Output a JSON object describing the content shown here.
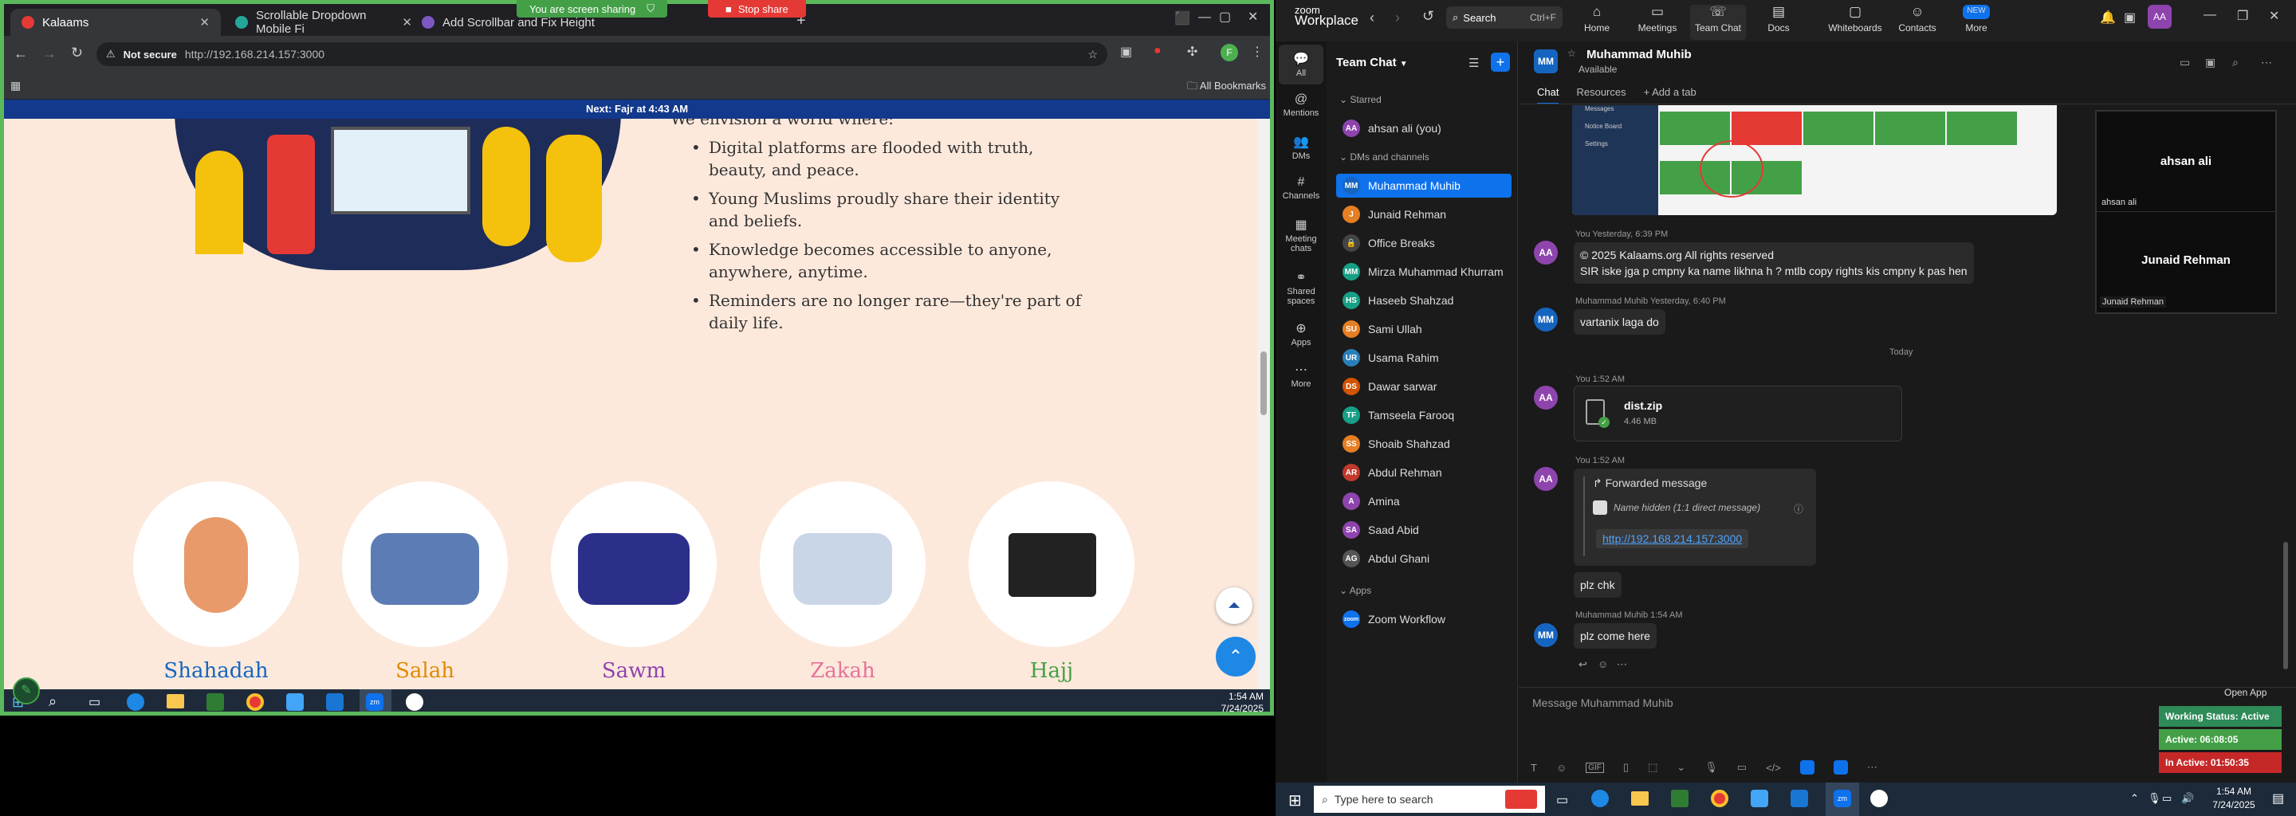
{
  "browser": {
    "tabs": [
      {
        "label": "Kalaams",
        "color": "#e53935"
      },
      {
        "label": "Scrollable Dropdown Mobile Fi",
        "color": "#26a69a"
      },
      {
        "label": "Add Scrollbar and Fix Height",
        "color": "#7e57c2"
      }
    ],
    "sharing_banner": "You are screen sharing",
    "stop_share": "Stop share",
    "not_secure": "Not secure",
    "url": "http://192.168.214.157:3000",
    "all_bookmarks": "All Bookmarks",
    "profile_initial": "F"
  },
  "page": {
    "banner": "Next: Fajr at 4:43 AM",
    "intro": "We envision a world where:",
    "bullets": [
      "Digital platforms are flooded with truth, beauty, and peace.",
      "Young Muslims proudly share their identity and beliefs.",
      "Knowledge becomes accessible to anyone, anywhere, anytime.",
      "Reminders are no longer rare—they're part of daily life."
    ],
    "pillars": [
      {
        "label": "Shahadah",
        "color": "#1565c0"
      },
      {
        "label": "Salah",
        "color": "#e08a00"
      },
      {
        "label": "Sawm",
        "color": "#8e44ad"
      },
      {
        "label": "Zakah",
        "color": "#e57399"
      },
      {
        "label": "Hajj",
        "color": "#43a047"
      }
    ]
  },
  "left_taskbar": {
    "time": "1:54 AM",
    "date": "7/24/2025"
  },
  "zoom": {
    "brand_top": "zoom",
    "brand_bottom": "Workplace",
    "search": "Search",
    "search_shortcut": "Ctrl+F",
    "nav": [
      "Home",
      "Meetings",
      "Team Chat",
      "Docs",
      "Whiteboards",
      "Contacts",
      "More"
    ],
    "nav_new_badge": "NEW",
    "avatar_initials": "AA",
    "rail": [
      "All",
      "Mentions",
      "DMs",
      "Channels",
      "Meeting chats",
      "Shared spaces",
      "Apps",
      "More"
    ],
    "list_title": "Team Chat",
    "starred_header": "Starred",
    "starred": [
      {
        "name": "ahsan ali (you)",
        "init": "AA",
        "color": "#8e44ad"
      }
    ],
    "dms_header": "DMs and channels",
    "dms": [
      {
        "name": "Muhammad Muhib",
        "init": "MM",
        "color": "#1565c0"
      },
      {
        "name": "Junaid Rehman",
        "init": "J",
        "color": "#e67e22"
      },
      {
        "name": "Office Breaks",
        "init": "🔒",
        "color": "#444"
      },
      {
        "name": "Mirza Muhammad Khurram",
        "init": "MM",
        "color": "#16a085"
      },
      {
        "name": "Haseeb Shahzad",
        "init": "HS",
        "color": "#16a085"
      },
      {
        "name": "Sami Ullah",
        "init": "SU",
        "color": "#e67e22"
      },
      {
        "name": "Usama Rahim",
        "init": "UR",
        "color": "#2980b9"
      },
      {
        "name": "Dawar sarwar",
        "init": "DS",
        "color": "#d35400"
      },
      {
        "name": "Tamseela Farooq",
        "init": "TF",
        "color": "#16a085"
      },
      {
        "name": "Shoaib Shahzad",
        "init": "SS",
        "color": "#e67e22"
      },
      {
        "name": "Abdul Rehman",
        "init": "AR",
        "color": "#c0392b"
      },
      {
        "name": "Amina",
        "init": "A",
        "color": "#8e44ad"
      },
      {
        "name": "Saad Abid",
        "init": "SA",
        "color": "#8e44ad"
      },
      {
        "name": "Abdul Ghani",
        "init": "AG",
        "color": "#555"
      }
    ],
    "apps_header": "Apps",
    "apps": [
      {
        "name": "Zoom Workflow",
        "init": "zoom",
        "color": "#0e72ed"
      }
    ],
    "chat_title": "Muhammad Muhib",
    "chat_initials": "MM",
    "chat_status": "Available",
    "chat_tabs": [
      "Chat",
      "Resources",
      "+ Add a tab"
    ],
    "messages": {
      "m1_meta": "You Yesterday, 6:39 PM",
      "m1_line1": "© 2025 Kalaams.org All rights reserved",
      "m1_line2": "SIR iske jga p cmpny ka name likhna h ?  mtlb copy rights kis cmpny k pas hen",
      "m2_meta": "Muhammad Muhib Yesterday, 6:40 PM",
      "m2_text": "vartanix laga do",
      "today": "Today",
      "m3_meta": "You 1:52 AM",
      "m3_file": "dist.zip",
      "m3_size": "4.46 MB",
      "m4_meta": "You 1:52 AM",
      "m4_fwd": "Forwarded message",
      "m4_hidden": "Name hidden (1:1 direct message)",
      "m4_link": "http://192.168.214.157:3000",
      "m4_text": "plz chk",
      "m5_meta": "Muhammad Muhib 1:54 AM",
      "m5_text": "plz come here"
    },
    "composer_placeholder": "Message Muhammad Muhib",
    "video": {
      "p1": "ahsan ali",
      "p1_tag": "ahsan ali",
      "p2": "Junaid Rehman",
      "p2_tag": "Junaid Rehman"
    },
    "open_app": "Open App",
    "status": {
      "working": "Working Status: Active",
      "active": "Active: 06:08:05",
      "inactive": "In Active: 01:50:35"
    },
    "screenshot_sidebar": [
      "Messages",
      "Notice Board",
      "Settings"
    ],
    "taskbar": {
      "search": "Type here to search",
      "time": "1:54 AM",
      "date": "7/24/2025"
    }
  }
}
